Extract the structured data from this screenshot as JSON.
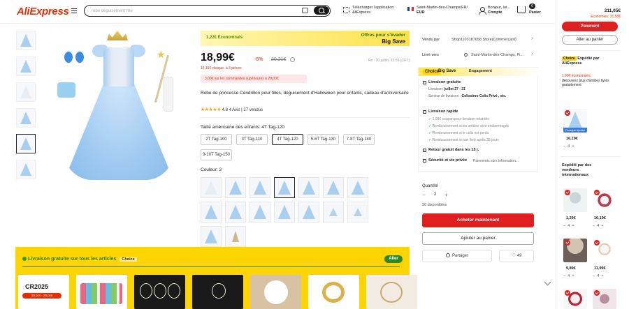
{
  "header": {
    "logo": "AliExpress",
    "search_placeholder": "robe déguisement fille",
    "app_label_1": "Télécharger l'application",
    "app_label_2": "AliExpress",
    "location_1": "Saint-Martin-des-Champs/FR/",
    "location_2": "EUR",
    "account_1": "Bonjour, lui...",
    "account_2": "Compte",
    "cart_count": "0",
    "cart_label": "Panier"
  },
  "product": {
    "deal_save": "1,22€ Économisés",
    "deal_offer_1": "Offres pour s'évader",
    "deal_offer_2": "Big Save",
    "price": "18,99€",
    "discount": "-6%",
    "old_price": "20,21€",
    "end_text": "Fin : 20 juillet, 23:59 (CET)",
    "per_piece": "16,15€ chaque, à 3 pièces",
    "promo": "3,00€ sur les commandes supérieures à 29,00€",
    "title": "Robe de princesse Cendrillon pour filles, déguisement d'Halloween pour enfants, cadeau d'anniversaire",
    "stars": "★★★★★",
    "rating_text": "4.8  4 Avis  |  27 vendus",
    "size_label": "Taille américaine des enfants: 4T Tag-120",
    "sizes": [
      "2T Tag-100",
      "3T Tag-110",
      "4T Tag-120",
      "5-6T Tag-130",
      "7-8T Tag-140",
      "9-10T Tag-150"
    ],
    "color_label": "Couleur: 3"
  },
  "seller": {
    "sold_by_label": "Vendu par",
    "sold_by_value": "Shop1103187658 Store(Commerçant)",
    "ship_to_label": "Livré vers",
    "ship_to_value": "Saint-Martin-des-Champs, Fi...",
    "choice": "Choice",
    "bigsave": "Big Save",
    "engagement": "Engagement",
    "free_delivery": "Livraison gratuite",
    "delivery_date_label": "Livraison:",
    "delivery_date": "juillet 27 - 31",
    "service_label": "Service de livraison :",
    "service_value": "Colissimo   Colis Privé , etc.",
    "fast_delivery": "Livraison rapide",
    "check_1": "1,00€ coupon pour livraison retardée",
    "check_2": "Remboursement si les articles sont endommagés",
    "check_3": "Remboursement si le colis est perdu",
    "check_4": "Remboursement si non livré après 35 jours",
    "free_return": "Retour gratuit dans les 15 j.",
    "security": "Sécurité et vie privée",
    "security_sub": "Paiements sûrs  Information...",
    "qty_label": "Quantité",
    "qty_value": "2",
    "available": "30 disponibles",
    "buy_now": "Acheter maintenant",
    "add_to_cart": "Ajouter au panier",
    "share": "Partager",
    "likes": "49"
  },
  "banner": {
    "title": "Livraison gratuite sur tous les articles",
    "choice": "Choice",
    "aller": "Aller",
    "cr_text": "CR2025",
    "cr_tag": "10 pcs - 20 pcs"
  },
  "sidebar": {
    "total": "211,05€",
    "savings": "Économies: 31,58€",
    "pay": "Paiement",
    "go_cart": "Aller au panier",
    "choice_badge": "Choice",
    "shipped_by_1": "Expédié par",
    "shipped_by_2": "AliExpress",
    "promo_red": "1,99€ économisés,",
    "promo_rest": "découvrez plus d'articles livrés gratuitement",
    "tag": "Presque épuisé",
    "p1_price": "16,19€",
    "p1_qty": "4",
    "vendors_1": "Expédié par des",
    "vendors_2": "vendeurs",
    "vendors_3": "internationaux",
    "p2_price": "1,29€",
    "p2_qty": "4",
    "p3_price": "10,19€",
    "p3_qty": "4",
    "p4_price": "9,89€",
    "p4_qty": "4",
    "p5_price": "11,99€",
    "p5_qty": "4"
  }
}
